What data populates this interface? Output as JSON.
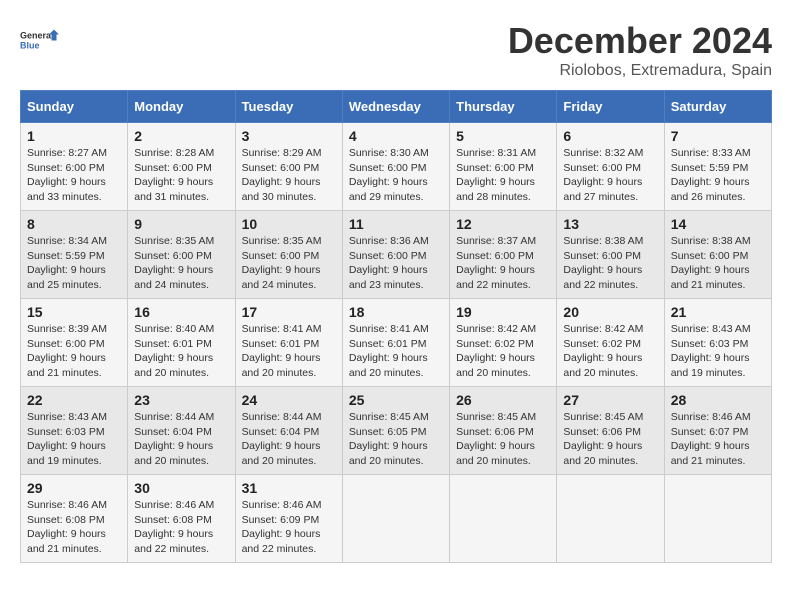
{
  "logo": {
    "line1": "General",
    "line2": "Blue"
  },
  "title": "December 2024",
  "location": "Riolobos, Extremadura, Spain",
  "days_of_week": [
    "Sunday",
    "Monday",
    "Tuesday",
    "Wednesday",
    "Thursday",
    "Friday",
    "Saturday"
  ],
  "weeks": [
    [
      {
        "day": "1",
        "sunrise": "8:27 AM",
        "sunset": "6:00 PM",
        "daylight": "9 hours and 33 minutes."
      },
      {
        "day": "2",
        "sunrise": "8:28 AM",
        "sunset": "6:00 PM",
        "daylight": "9 hours and 31 minutes."
      },
      {
        "day": "3",
        "sunrise": "8:29 AM",
        "sunset": "6:00 PM",
        "daylight": "9 hours and 30 minutes."
      },
      {
        "day": "4",
        "sunrise": "8:30 AM",
        "sunset": "6:00 PM",
        "daylight": "9 hours and 29 minutes."
      },
      {
        "day": "5",
        "sunrise": "8:31 AM",
        "sunset": "6:00 PM",
        "daylight": "9 hours and 28 minutes."
      },
      {
        "day": "6",
        "sunrise": "8:32 AM",
        "sunset": "6:00 PM",
        "daylight": "9 hours and 27 minutes."
      },
      {
        "day": "7",
        "sunrise": "8:33 AM",
        "sunset": "5:59 PM",
        "daylight": "9 hours and 26 minutes."
      }
    ],
    [
      {
        "day": "8",
        "sunrise": "8:34 AM",
        "sunset": "5:59 PM",
        "daylight": "9 hours and 25 minutes."
      },
      {
        "day": "9",
        "sunrise": "8:35 AM",
        "sunset": "6:00 PM",
        "daylight": "9 hours and 24 minutes."
      },
      {
        "day": "10",
        "sunrise": "8:35 AM",
        "sunset": "6:00 PM",
        "daylight": "9 hours and 24 minutes."
      },
      {
        "day": "11",
        "sunrise": "8:36 AM",
        "sunset": "6:00 PM",
        "daylight": "9 hours and 23 minutes."
      },
      {
        "day": "12",
        "sunrise": "8:37 AM",
        "sunset": "6:00 PM",
        "daylight": "9 hours and 22 minutes."
      },
      {
        "day": "13",
        "sunrise": "8:38 AM",
        "sunset": "6:00 PM",
        "daylight": "9 hours and 22 minutes."
      },
      {
        "day": "14",
        "sunrise": "8:38 AM",
        "sunset": "6:00 PM",
        "daylight": "9 hours and 21 minutes."
      }
    ],
    [
      {
        "day": "15",
        "sunrise": "8:39 AM",
        "sunset": "6:00 PM",
        "daylight": "9 hours and 21 minutes."
      },
      {
        "day": "16",
        "sunrise": "8:40 AM",
        "sunset": "6:01 PM",
        "daylight": "9 hours and 20 minutes."
      },
      {
        "day": "17",
        "sunrise": "8:41 AM",
        "sunset": "6:01 PM",
        "daylight": "9 hours and 20 minutes."
      },
      {
        "day": "18",
        "sunrise": "8:41 AM",
        "sunset": "6:01 PM",
        "daylight": "9 hours and 20 minutes."
      },
      {
        "day": "19",
        "sunrise": "8:42 AM",
        "sunset": "6:02 PM",
        "daylight": "9 hours and 20 minutes."
      },
      {
        "day": "20",
        "sunrise": "8:42 AM",
        "sunset": "6:02 PM",
        "daylight": "9 hours and 20 minutes."
      },
      {
        "day": "21",
        "sunrise": "8:43 AM",
        "sunset": "6:03 PM",
        "daylight": "9 hours and 19 minutes."
      }
    ],
    [
      {
        "day": "22",
        "sunrise": "8:43 AM",
        "sunset": "6:03 PM",
        "daylight": "9 hours and 19 minutes."
      },
      {
        "day": "23",
        "sunrise": "8:44 AM",
        "sunset": "6:04 PM",
        "daylight": "9 hours and 20 minutes."
      },
      {
        "day": "24",
        "sunrise": "8:44 AM",
        "sunset": "6:04 PM",
        "daylight": "9 hours and 20 minutes."
      },
      {
        "day": "25",
        "sunrise": "8:45 AM",
        "sunset": "6:05 PM",
        "daylight": "9 hours and 20 minutes."
      },
      {
        "day": "26",
        "sunrise": "8:45 AM",
        "sunset": "6:06 PM",
        "daylight": "9 hours and 20 minutes."
      },
      {
        "day": "27",
        "sunrise": "8:45 AM",
        "sunset": "6:06 PM",
        "daylight": "9 hours and 20 minutes."
      },
      {
        "day": "28",
        "sunrise": "8:46 AM",
        "sunset": "6:07 PM",
        "daylight": "9 hours and 21 minutes."
      }
    ],
    [
      {
        "day": "29",
        "sunrise": "8:46 AM",
        "sunset": "6:08 PM",
        "daylight": "9 hours and 21 minutes."
      },
      {
        "day": "30",
        "sunrise": "8:46 AM",
        "sunset": "6:08 PM",
        "daylight": "9 hours and 22 minutes."
      },
      {
        "day": "31",
        "sunrise": "8:46 AM",
        "sunset": "6:09 PM",
        "daylight": "9 hours and 22 minutes."
      },
      null,
      null,
      null,
      null
    ]
  ]
}
